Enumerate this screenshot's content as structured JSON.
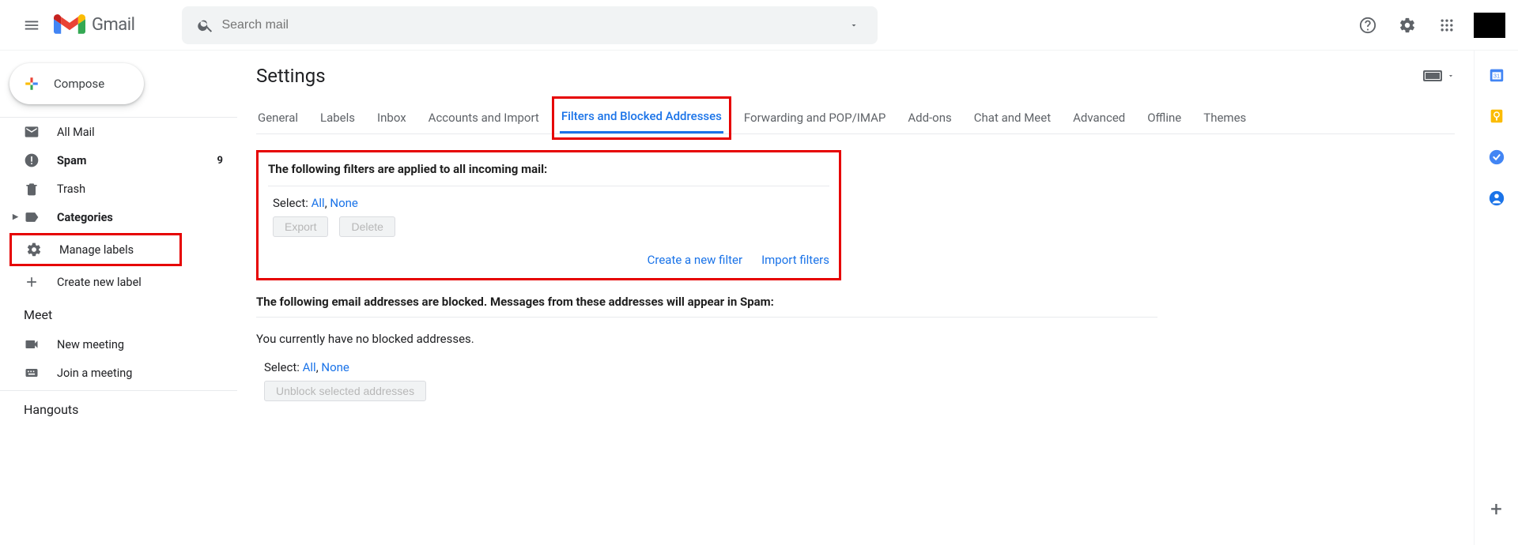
{
  "header": {
    "app_name": "Gmail",
    "search_placeholder": "Search mail"
  },
  "compose_label": "Compose",
  "sidebar": {
    "items": [
      {
        "label": "All Mail",
        "count": ""
      },
      {
        "label": "Spam",
        "count": "9"
      },
      {
        "label": "Trash",
        "count": ""
      },
      {
        "label": "Categories",
        "count": ""
      },
      {
        "label": "Manage labels",
        "count": ""
      },
      {
        "label": "Create new label",
        "count": ""
      }
    ],
    "meet_title": "Meet",
    "meet_items": [
      {
        "label": "New meeting"
      },
      {
        "label": "Join a meeting"
      }
    ],
    "hangouts_title": "Hangouts"
  },
  "settings": {
    "title": "Settings",
    "tabs": [
      "General",
      "Labels",
      "Inbox",
      "Accounts and Import",
      "Filters and Blocked Addresses",
      "Forwarding and POP/IMAP",
      "Add-ons",
      "Chat and Meet",
      "Advanced",
      "Offline",
      "Themes"
    ],
    "filters": {
      "heading": "The following filters are applied to all incoming mail:",
      "select_label": "Select:",
      "select_all": "All",
      "select_none": "None",
      "export_btn": "Export",
      "delete_btn": "Delete",
      "create_link": "Create a new filter",
      "import_link": "Import filters"
    },
    "blocked": {
      "heading": "The following email addresses are blocked. Messages from these addresses will appear in Spam:",
      "empty_msg": "You currently have no blocked addresses.",
      "select_label": "Select:",
      "select_all": "All",
      "select_none": "None",
      "unblock_btn": "Unblock selected addresses"
    }
  }
}
